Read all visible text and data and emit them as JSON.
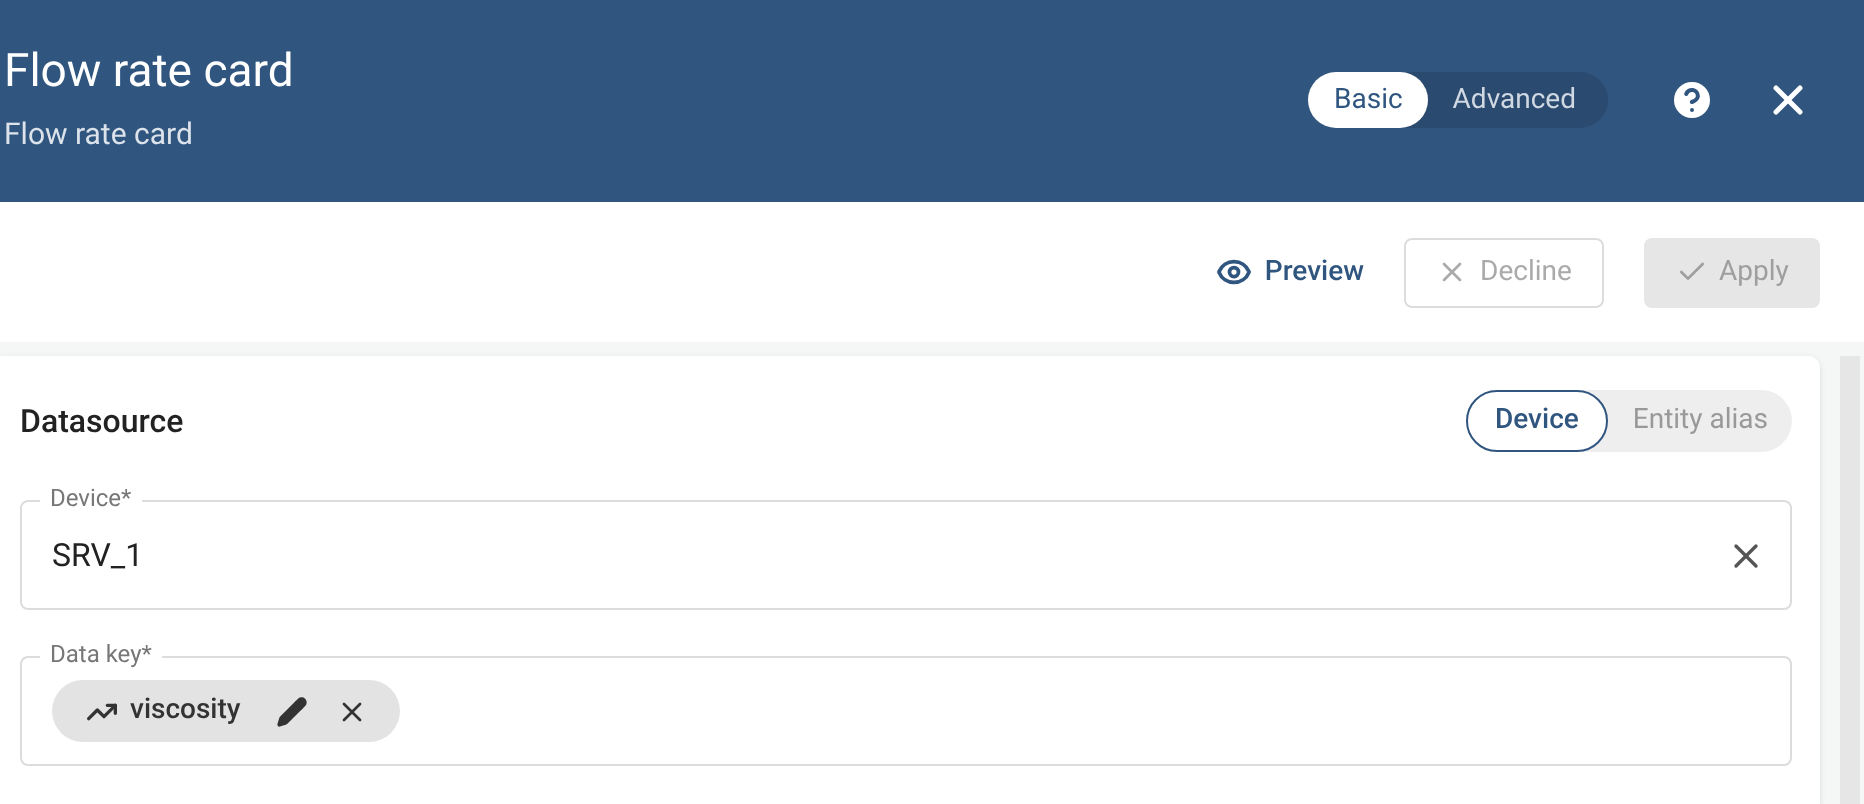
{
  "header": {
    "title": "Flow rate card",
    "subtitle": "Flow rate card",
    "modes": [
      {
        "label": "Basic",
        "selected": true
      },
      {
        "label": "Advanced",
        "selected": false
      }
    ]
  },
  "toolbar": {
    "preview": "Preview",
    "decline": {
      "label": "Decline",
      "disabled": true
    },
    "apply": {
      "label": "Apply",
      "disabled": true
    }
  },
  "datasource": {
    "title": "Datasource",
    "types": [
      {
        "label": "Device",
        "selected": true
      },
      {
        "label": "Entity alias",
        "selected": false
      }
    ],
    "device": {
      "label": "Device*",
      "value": "SRV_1"
    },
    "data_key": {
      "label": "Data key*",
      "chips": [
        {
          "label": "viscosity"
        }
      ]
    }
  }
}
